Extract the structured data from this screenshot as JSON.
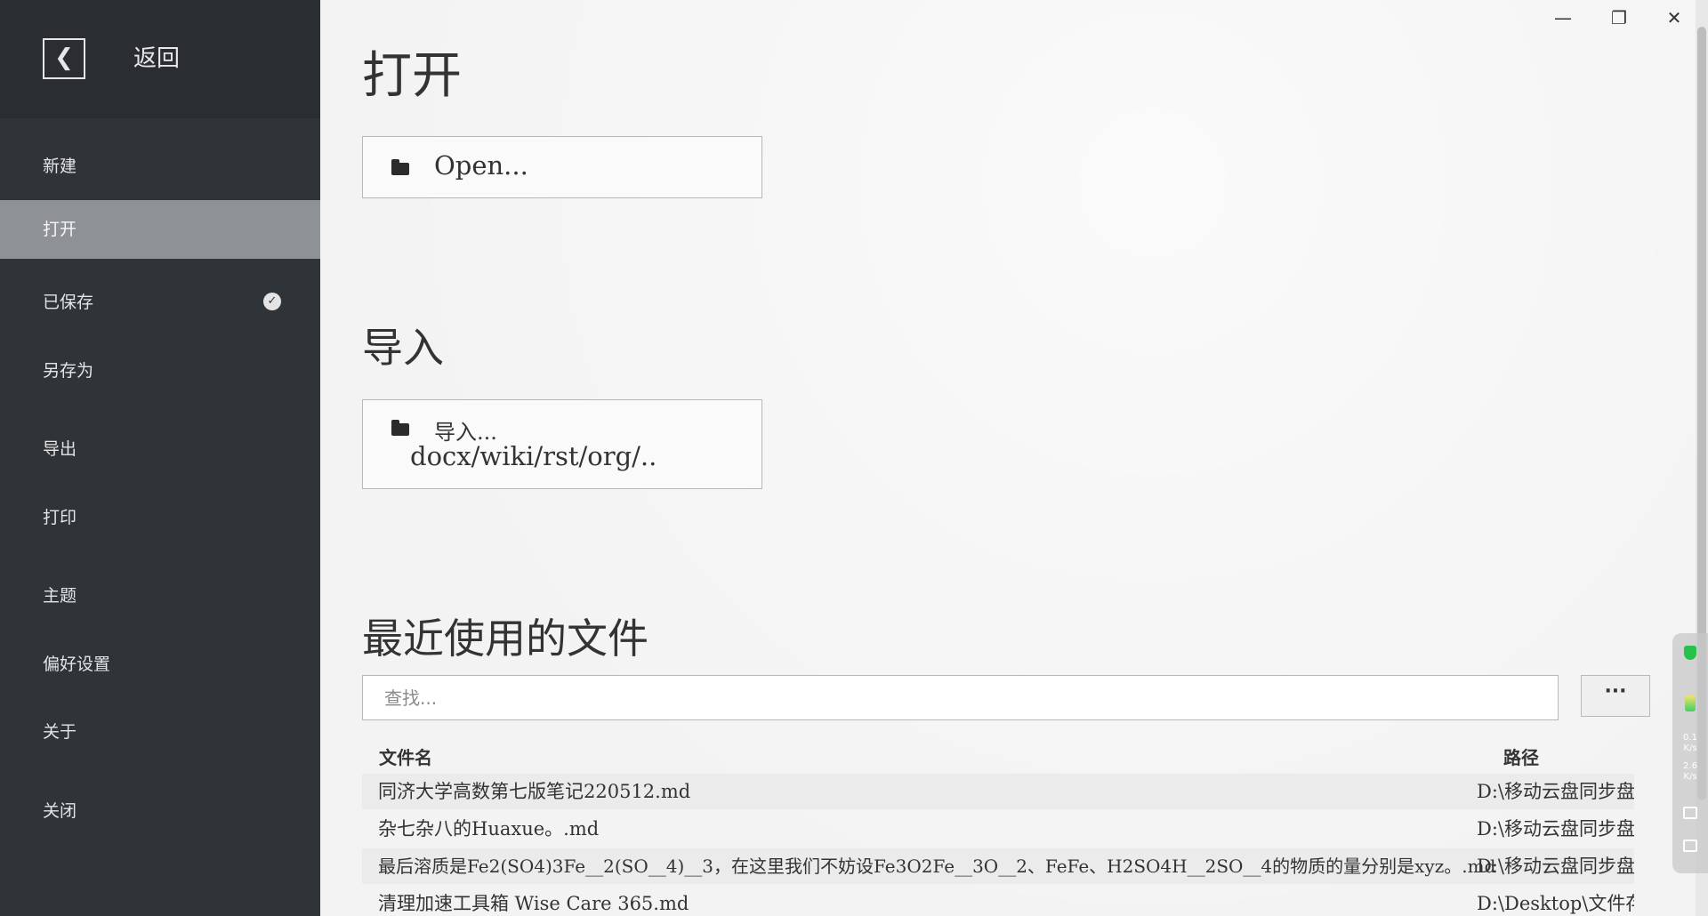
{
  "sidebar": {
    "back_icon": "chevron-left-icon",
    "back_label": "返回",
    "items": [
      {
        "label": "新建"
      },
      {
        "label": "打开"
      },
      {
        "label": "已保存",
        "icon": "check-circle-icon"
      },
      {
        "label": "另存为"
      },
      {
        "label": "导出"
      },
      {
        "label": "打印"
      },
      {
        "label": "主题"
      },
      {
        "label": "偏好设置"
      },
      {
        "label": "关于"
      },
      {
        "label": "关闭"
      }
    ],
    "active_item": "打开",
    "colors": {
      "background": "#2f3439",
      "active": "#8e9296"
    }
  },
  "window_controls": {
    "minimize": "—",
    "restore": "❐",
    "close": "✕"
  },
  "open_section": {
    "title": "打开",
    "button_label": "Open...",
    "button_icon": "folder-icon"
  },
  "import_section": {
    "title": "导入",
    "button_label": "导入...",
    "button_sublabel": "docx/wiki/rst/org/..",
    "button_icon": "folder-icon"
  },
  "recent_section": {
    "title": "最近使用的文件",
    "search_placeholder": "查找...",
    "more_label": "···",
    "columns": {
      "name": "文件名",
      "path": "路径"
    },
    "files": [
      {
        "name": "同济大学高数第七版笔记220512.md",
        "path": "D:\\移动云盘同步盘\\"
      },
      {
        "name": "杂七杂八的Huaxue。.md",
        "path": "D:\\移动云盘同步盘\\"
      },
      {
        "name": "最后溶质是Fe2(SO4)3Fe__2(SO__4)__3，在这里我们不妨设Fe3O2Fe__3O__2、FeFe、H2SO4H__2SO__4的物质的量分别是xyz。.md",
        "path": "D:\\移动云盘同步盘\\"
      },
      {
        "name": "清理加速工具箱 Wise Care 365.md",
        "path": "D:\\Desktop\\文件存"
      }
    ]
  },
  "net_widget": {
    "up_rate": "0.1",
    "up_unit": "K/s",
    "down_rate": "2.6",
    "down_unit": "K/s"
  }
}
